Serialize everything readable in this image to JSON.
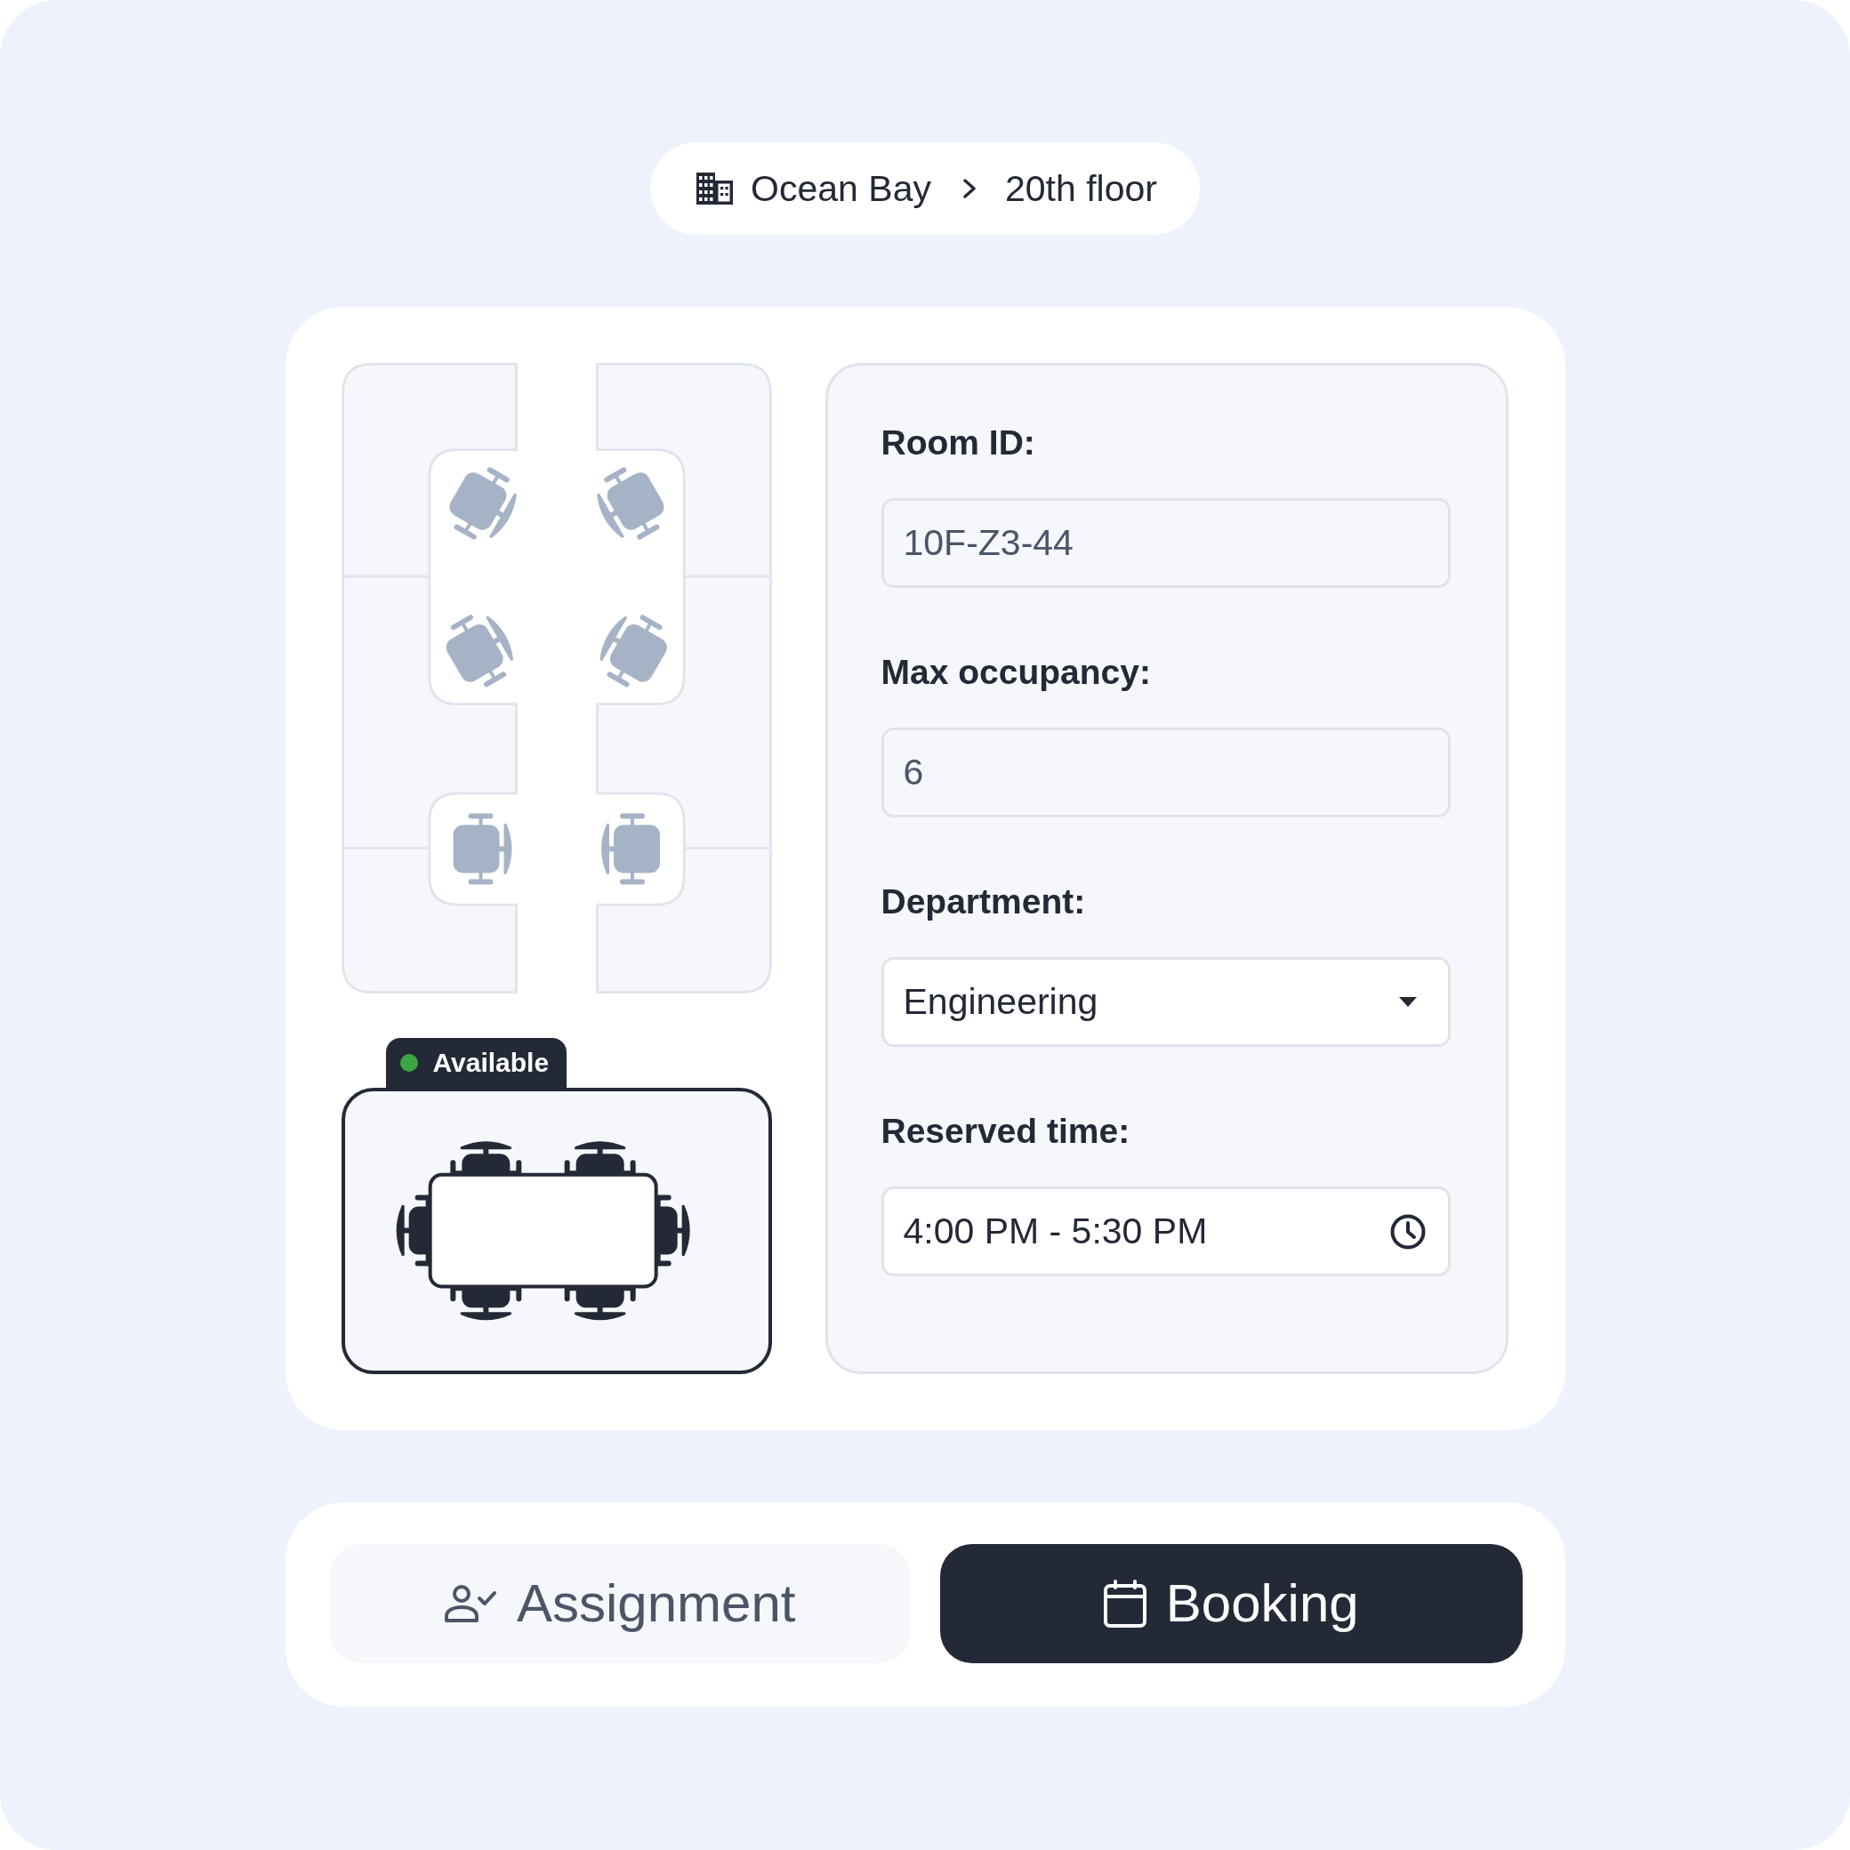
{
  "breadcrumb": {
    "items": [
      {
        "label": "Ocean Bay"
      },
      {
        "label": "20th floor"
      }
    ]
  },
  "room_preview": {
    "status": {
      "label": "Available",
      "available": true
    }
  },
  "form": {
    "fields": [
      {
        "label": "Room ID:",
        "kind": "text",
        "value": "10F-Z3-44",
        "disabled": true
      },
      {
        "label": "Max occupancy:",
        "kind": "text",
        "value": "6",
        "disabled": true
      },
      {
        "label": "Department:",
        "kind": "select",
        "value": "Engineering",
        "disabled": false
      },
      {
        "label": "Reserved time:",
        "kind": "time",
        "value": "4:00 PM - 5:30 PM",
        "disabled": false
      }
    ]
  },
  "actions": [
    {
      "label": "Assignment",
      "kind": "assignment",
      "selected": false
    },
    {
      "label": "Booking",
      "kind": "booking",
      "selected": true
    }
  ]
}
